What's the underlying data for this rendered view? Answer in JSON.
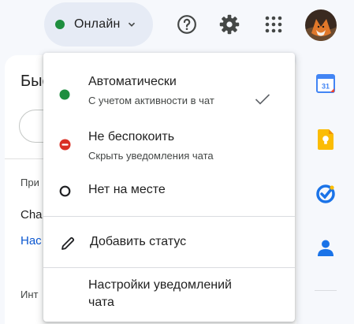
{
  "header": {
    "status_chip": {
      "label": "Онлайн",
      "status_color": "#1e8e3e"
    },
    "icons": [
      "help-icon",
      "settings-icon",
      "apps-grid-icon",
      "account-avatar"
    ]
  },
  "background": {
    "title": "Быс",
    "section_label": "При",
    "chat_item": "Cha",
    "link_text": "Нас",
    "section2_label": "Инт"
  },
  "status_menu": {
    "items": [
      {
        "title": "Автоматически",
        "subtitle": "С учетом активности в чат",
        "icon": "green-dot-icon",
        "selected": true
      },
      {
        "title": "Не беспокоить",
        "subtitle": "Скрыть уведомления чата",
        "icon": "do-not-disturb-icon",
        "selected": false
      },
      {
        "title": "Нет на месте",
        "icon": "away-ring-icon",
        "selected": false
      }
    ],
    "add_status": "Добавить статус",
    "notifications_settings_line1": "Настройки уведомлений",
    "notifications_settings_line2": "чата"
  },
  "side_panel": {
    "icons": [
      "calendar-icon",
      "keep-icon",
      "tasks-icon",
      "contacts-icon"
    ],
    "calendar_day": "31"
  },
  "colors": {
    "online_green": "#1e8e3e",
    "dnd_red": "#d93025",
    "link_blue": "#0b57d0",
    "keep_yellow": "#fbbc04",
    "tasks_blue": "#1a73e8"
  }
}
